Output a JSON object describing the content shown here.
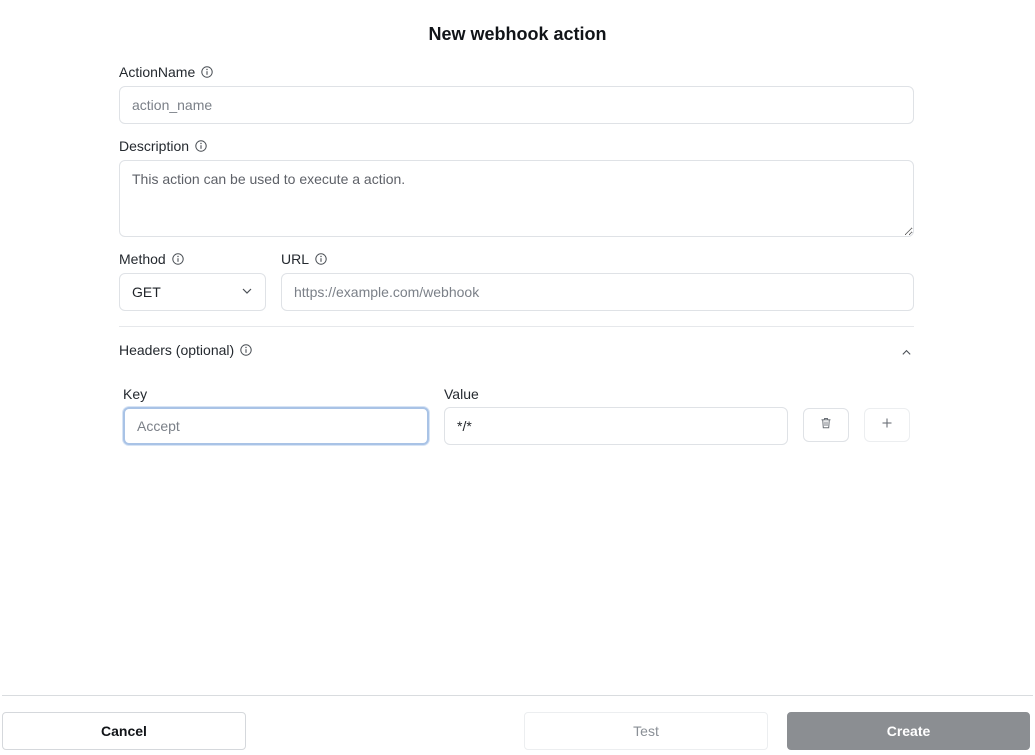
{
  "dialog": {
    "title": "New webhook action"
  },
  "fields": {
    "action_name": {
      "label": "ActionName",
      "placeholder": "action_name",
      "value": ""
    },
    "description": {
      "label": "Description",
      "placeholder": "This action can be used to execute a action.",
      "value": ""
    },
    "method": {
      "label": "Method",
      "selected": "GET"
    },
    "url": {
      "label": "URL",
      "placeholder": "https://example.com/webhook",
      "value": ""
    }
  },
  "headers": {
    "label": "Headers (optional)",
    "expanded": true,
    "key_label": "Key",
    "value_label": "Value",
    "rows": [
      {
        "key_placeholder": "Accept",
        "value": "*/*"
      }
    ]
  },
  "footer": {
    "cancel_label": "Cancel",
    "test_label": "Test",
    "create_label": "Create"
  },
  "icons": {
    "info": "info-icon",
    "chevron_down": "chevron-down-icon",
    "chevron_up": "chevron-up-icon",
    "trash": "trash-icon",
    "plus": "plus-icon"
  }
}
